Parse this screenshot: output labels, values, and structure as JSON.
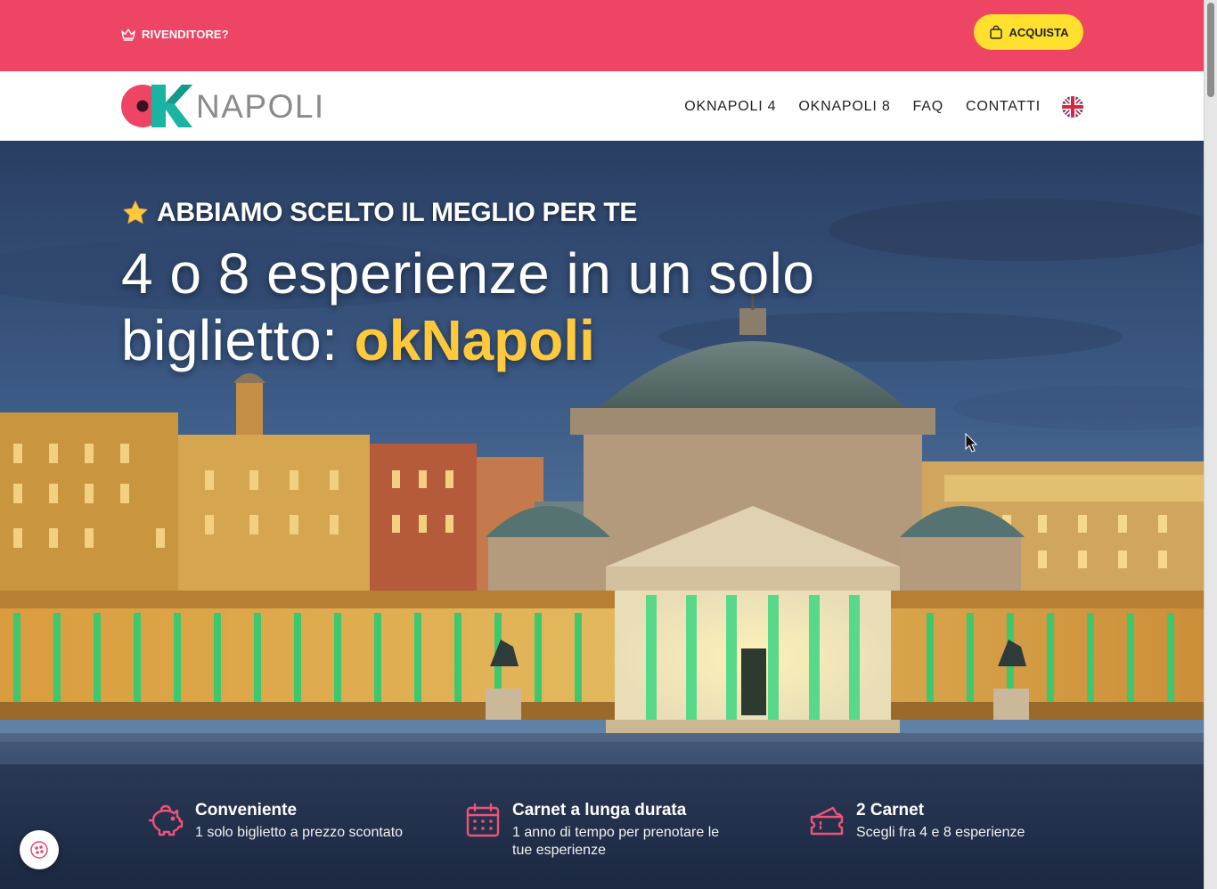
{
  "topbar": {
    "reseller_label": "RIVENDITORE?",
    "buy_label": "ACQUISTA",
    "background": "#ef4565",
    "buy_color": "#ffe02e"
  },
  "brand": {
    "logo_text": "NAPOLI",
    "logo_icon": "ok-logo-icon"
  },
  "nav": {
    "items": [
      {
        "label": "OKNAPOLI 4"
      },
      {
        "label": "OKNAPOLI 8"
      },
      {
        "label": "FAQ"
      },
      {
        "label": "CONTATTI"
      }
    ],
    "language_icon": "uk-flag-icon"
  },
  "hero": {
    "eyebrow": "ABBIAMO SCELTO IL MEGLIO PER TE",
    "headline_part1": "4 o 8 esperienze in un solo",
    "headline_part2": "biglietto: ",
    "headline_brand": "okNapoli",
    "brand_color": "#ffc93c"
  },
  "features": [
    {
      "icon": "piggy-bank-icon",
      "title": "Conveniente",
      "desc": "1 solo biglietto a prezzo scontato"
    },
    {
      "icon": "calendar-icon",
      "title": "Carnet a lunga durata",
      "desc": "1 anno di tempo per prenotare le tue esperienze"
    },
    {
      "icon": "tickets-icon",
      "title": "2 Carnet",
      "desc": "Scegli fra 4 e 8 esperienze"
    }
  ],
  "cookie_icon": "cookie-icon"
}
